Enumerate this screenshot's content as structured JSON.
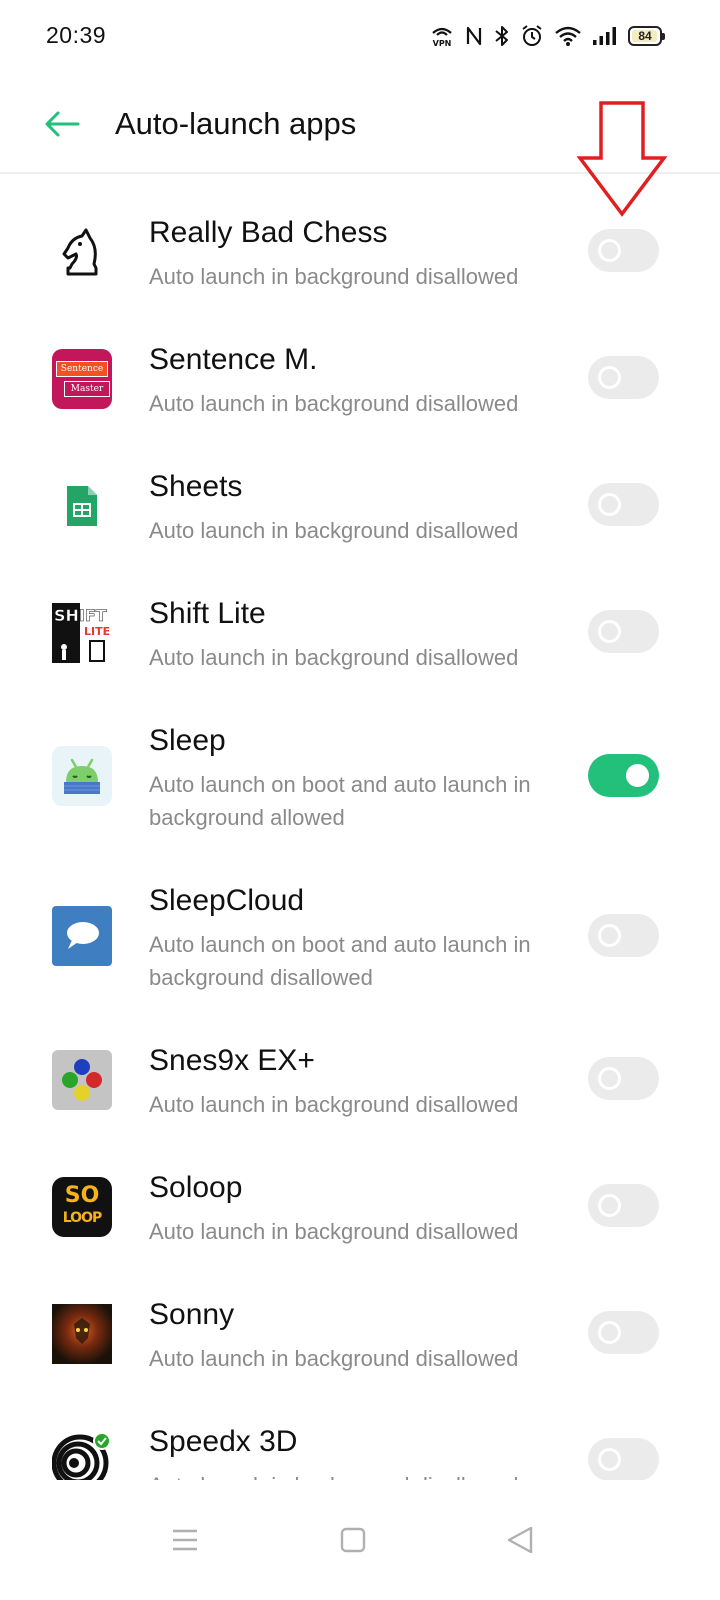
{
  "status_bar": {
    "time": "20:39",
    "battery_level": "84",
    "icons": [
      "vpn-icon",
      "nfc-icon",
      "bluetooth-icon",
      "alarm-icon",
      "wifi-icon",
      "signal-icon",
      "battery-icon"
    ]
  },
  "header": {
    "title": "Auto-launch apps",
    "back_icon": "back-arrow-icon"
  },
  "colors": {
    "accent": "#22c07a",
    "toggle_off": "#ebebeb",
    "annotation": "#e02020"
  },
  "apps": [
    {
      "name": "Really Bad Chess",
      "desc": "Auto launch in background disallowed",
      "enabled": false,
      "icon": "chess-knight-icon"
    },
    {
      "name": "Sentence M.",
      "desc": "Auto launch in background disallowed",
      "enabled": false,
      "icon": "sentence-master-icon",
      "icon_text_1": "Sentence",
      "icon_text_2": "Master"
    },
    {
      "name": "Sheets",
      "desc": "Auto launch in background disallowed",
      "enabled": false,
      "icon": "sheets-icon"
    },
    {
      "name": "Shift Lite",
      "desc": "Auto launch in background disallowed",
      "enabled": false,
      "icon": "shift-lite-icon",
      "icon_text_1": "SHIFT",
      "icon_text_2": "LITE"
    },
    {
      "name": "Sleep",
      "desc": "Auto launch on boot and auto launch in background allowed",
      "enabled": true,
      "icon": "sleep-android-icon"
    },
    {
      "name": "SleepCloud",
      "desc": "Auto launch on boot and auto launch in background disallowed",
      "enabled": false,
      "icon": "sleepcloud-icon"
    },
    {
      "name": "Snes9x EX+",
      "desc": "Auto launch in background disallowed",
      "enabled": false,
      "icon": "snes-gamepad-icon"
    },
    {
      "name": "Soloop",
      "desc": "Auto launch in background disallowed",
      "enabled": false,
      "icon": "soloop-icon",
      "icon_text_1": "SO",
      "icon_text_2": "LOOP"
    },
    {
      "name": "Sonny",
      "desc": "Auto launch in background disallowed",
      "enabled": false,
      "icon": "sonny-icon"
    },
    {
      "name": "Speedx 3D",
      "desc": "Auto launch in background disallowed",
      "enabled": false,
      "icon": "speedx-spiral-icon"
    }
  ],
  "nav_bar": {
    "buttons": [
      "menu-icon",
      "home-icon",
      "back-icon"
    ]
  }
}
